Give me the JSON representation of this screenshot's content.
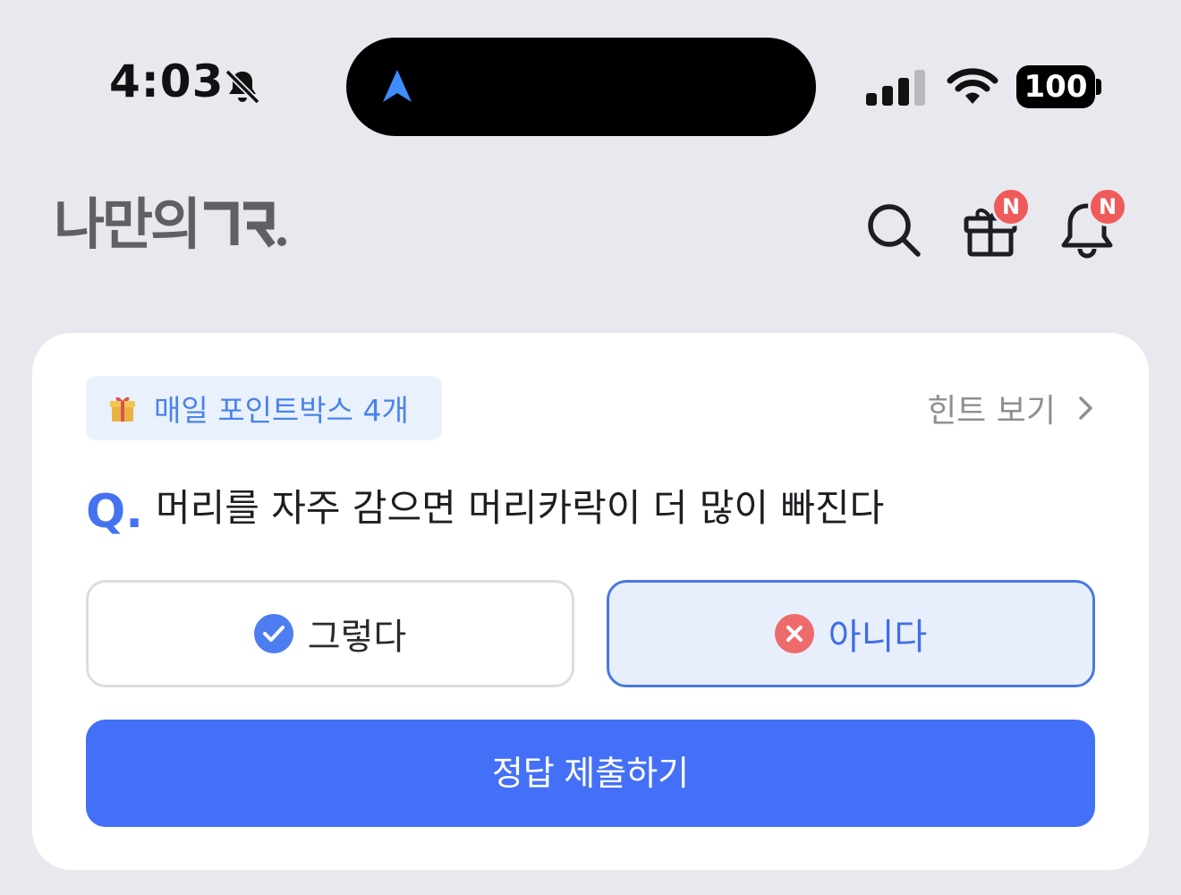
{
  "status_bar": {
    "time": "4:03",
    "battery": "100"
  },
  "header": {
    "logo_text": "나만의"
  },
  "badges": {
    "gift": "N",
    "bell": "N"
  },
  "quiz": {
    "points_chip": "매일 포인트박스 4개",
    "hint_link": "힌트 보기",
    "q_mark": "Q.",
    "question": "머리를 자주 감으면 머리카락이 더 많이 빠진다",
    "answer_yes": "그렇다",
    "answer_no": "아니다",
    "submit": "정답 제출하기"
  },
  "colors": {
    "accent": "#4470f7",
    "badge": "#ef5a5a",
    "selected_bg": "#e7effc",
    "background": "#e8e9ef"
  },
  "icons": [
    "bell-off-icon",
    "location-arrow-icon",
    "signal-icon",
    "wifi-icon",
    "search-icon",
    "gift-icon",
    "bell-icon",
    "check-circle-icon",
    "x-circle-icon",
    "chevron-right-icon"
  ]
}
